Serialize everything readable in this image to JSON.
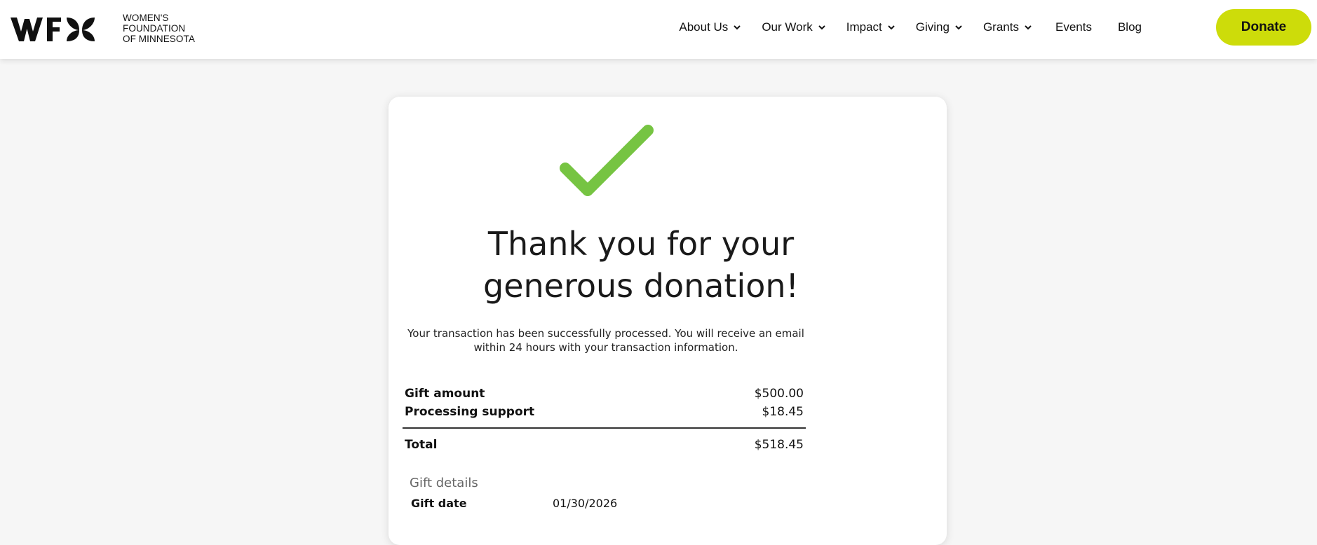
{
  "header": {
    "logo": {
      "lines": [
        "WOMEN'S",
        "FOUNDATION",
        "OF MINNESOTA"
      ]
    },
    "nav": [
      {
        "label": "About Us",
        "has_dropdown": true
      },
      {
        "label": "Our Work",
        "has_dropdown": true
      },
      {
        "label": "Impact",
        "has_dropdown": true
      },
      {
        "label": "Giving",
        "has_dropdown": true
      },
      {
        "label": "Grants",
        "has_dropdown": true
      },
      {
        "label": "Events",
        "has_dropdown": false
      },
      {
        "label": "Blog",
        "has_dropdown": false
      }
    ],
    "donate_label": "Donate"
  },
  "confirmation": {
    "icon": "checkmark-icon",
    "heading_line1": "Thank you for your",
    "heading_line2": "generous donation!",
    "message_line1": "Your transaction has been successfully processed. You will receive an email",
    "message_line2": "within 24 hours with your transaction information.",
    "summary": {
      "gift_amount_label": "Gift amount",
      "gift_amount_value": "$500.00",
      "processing_label": "Processing support",
      "processing_value": "$18.45",
      "total_label": "Total",
      "total_value": "$518.45"
    },
    "details": {
      "title": "Gift details",
      "gift_date_label": "Gift date",
      "gift_date_value": "01/30/2026"
    }
  },
  "colors": {
    "accent": "#cddc0a",
    "check_green": "#76c442",
    "page_bg": "#f6f6f6"
  }
}
